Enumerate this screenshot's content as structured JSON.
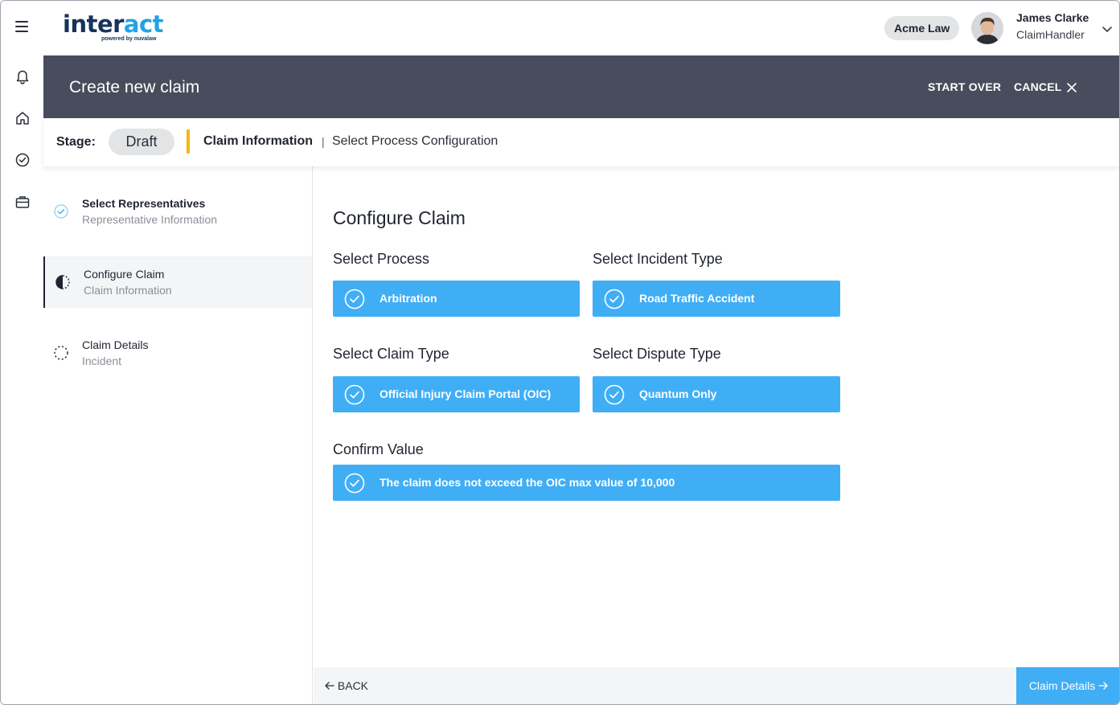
{
  "app": {
    "logo": {
      "part1": "inter",
      "part2": "act",
      "tagline": "powered by nuvalaw"
    },
    "organization": "Acme Law",
    "user": {
      "name": "James Clarke",
      "role": "ClaimHandler"
    }
  },
  "rail": {
    "items": [
      {
        "icon": "bell-icon"
      },
      {
        "icon": "home-icon"
      },
      {
        "icon": "check-circle-icon"
      },
      {
        "icon": "briefcase-icon"
      }
    ]
  },
  "header": {
    "title": "Create new claim",
    "start_over": "START OVER",
    "cancel": "CANCEL"
  },
  "stage": {
    "label": "Stage:",
    "value": "Draft",
    "crumbs": [
      "Claim Information",
      "Select Process Configuration"
    ],
    "separator": "|"
  },
  "steps": [
    {
      "title": "Select Representatives",
      "subtitle": "Representative Information",
      "status": "complete"
    },
    {
      "title": "Configure Claim",
      "subtitle": "Claim Information",
      "status": "in-progress"
    },
    {
      "title": "Claim Details",
      "subtitle": "Incident",
      "status": "pending"
    }
  ],
  "main": {
    "title": "Configure Claim",
    "fields": {
      "process": {
        "label": "Select Process",
        "value": "Arbitration"
      },
      "incident_type": {
        "label": "Select Incident Type",
        "value": "Road Traffic Accident"
      },
      "claim_type": {
        "label": "Select Claim Type",
        "value": "Official Injury Claim Portal (OIC)"
      },
      "dispute_type": {
        "label": "Select Dispute Type",
        "value": "Quantum Only"
      },
      "confirm_value": {
        "label": "Confirm Value",
        "value": "The claim does not exceed the OIC max value of 10,000"
      }
    }
  },
  "footer": {
    "back": "BACK",
    "next": "Claim Details"
  },
  "colors": {
    "accent": "#40aef5",
    "banner": "#474d5c",
    "stage_divider": "#f2b713",
    "logo_dark": "#17335c",
    "logo_light": "#21a3e6"
  }
}
